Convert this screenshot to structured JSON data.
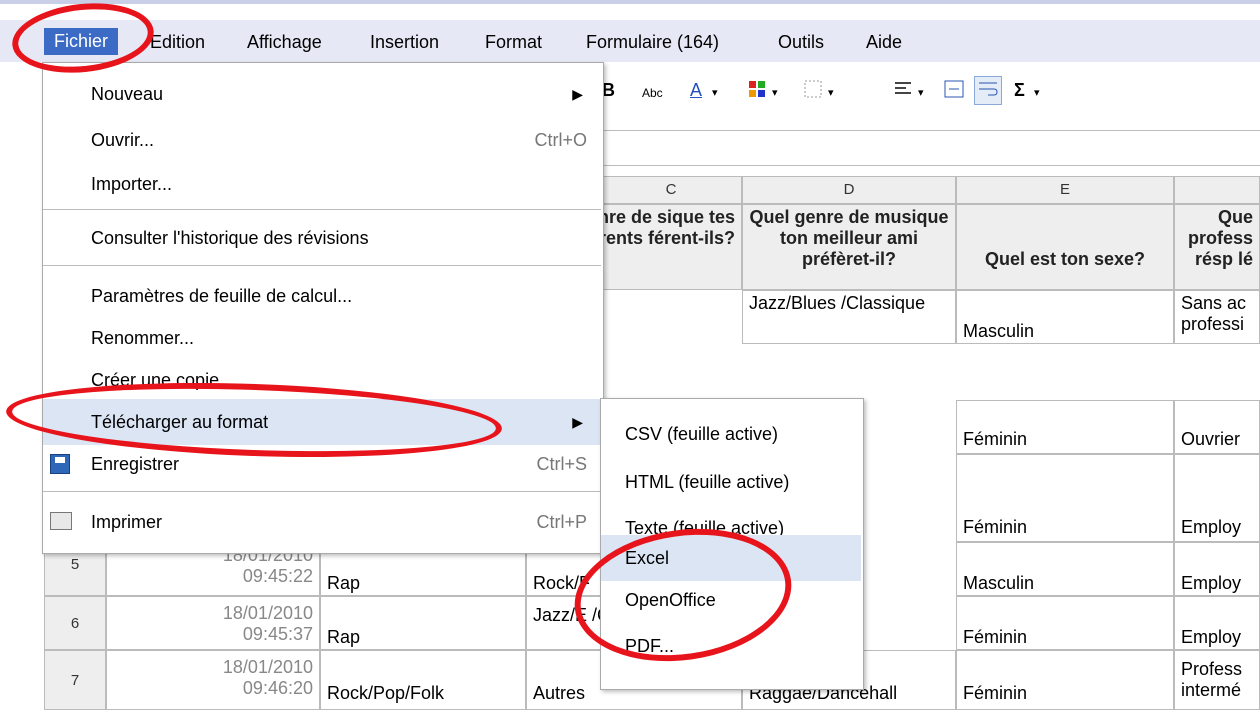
{
  "menubar": {
    "items": [
      "Fichier",
      "Edition",
      "Affichage",
      "Insertion",
      "Format",
      "Formulaire (164)",
      "Outils",
      "Aide"
    ]
  },
  "toolbar": {
    "bold": "B",
    "abc": "Abc",
    "color": "A",
    "sigma": "Σ"
  },
  "columns": [
    "C",
    "D",
    "E"
  ],
  "header_row": {
    "c": "l genre de sique tes parents férent-ils?",
    "d": "Quel genre de musique ton meilleur ami préfèret-il?",
    "e": "Quel est ton sexe?",
    "f": "Que profess résp lé"
  },
  "rows": [
    {
      "d": "Jazz/Blues /Classique",
      "e": "Masculin",
      "f": "Sans ac professi"
    },
    {
      "e": "Féminin",
      "f": "Ouvrier"
    },
    {
      "e": "Féminin",
      "f": "Employ"
    },
    {
      "num": "5",
      "date": "18/01/2010",
      "time": "09:45:22",
      "b": "Rap",
      "c": "Rock/F",
      "e": "Masculin",
      "f": "Employ"
    },
    {
      "num": "6",
      "date": "18/01/2010",
      "time": "09:45:37",
      "b": "Rap",
      "c": "Jazz/E /Class",
      "e": "Féminin",
      "f": "Employ"
    },
    {
      "num": "7",
      "date": "18/01/2010",
      "time": "09:46:20",
      "b": "Rock/Pop/Folk",
      "c": "Autres",
      "d": "Raggae/Dancehall",
      "e": "Féminin",
      "f": "Profess intermé"
    }
  ],
  "file_menu": {
    "nouveau": "Nouveau",
    "ouvrir": "Ouvrir...",
    "ouvrir_sc": "Ctrl+O",
    "importer": "Importer...",
    "historique": "Consulter l'historique des révisions",
    "parametres": "Paramètres de feuille de calcul...",
    "renommer": "Renommer...",
    "copie": "Créer une copie...",
    "telecharger": "Télécharger au format",
    "enregistrer": "Enregistrer",
    "enregistrer_sc": "Ctrl+S",
    "imprimer": "Imprimer",
    "imprimer_sc": "Ctrl+P"
  },
  "download_submenu": [
    "CSV (feuille active)",
    "HTML (feuille active)",
    "Texte (feuille active)",
    "Excel",
    "OpenOffice",
    "PDF..."
  ],
  "annotation_color": "#e8141b"
}
